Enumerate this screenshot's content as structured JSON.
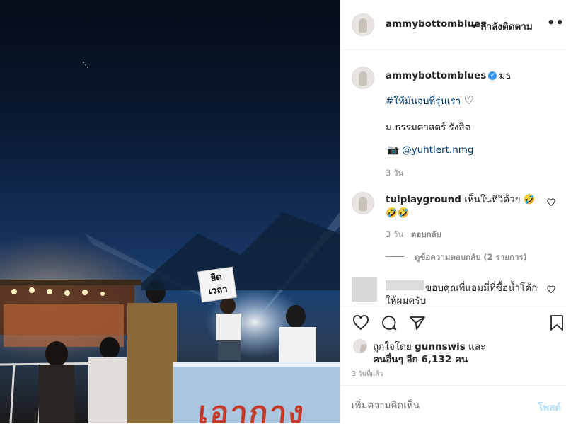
{
  "photo": {
    "sign_line1": "ยืด",
    "sign_line2": "เวลา",
    "banner_text": "เอากาง"
  },
  "header": {
    "username": "ammybottomblues",
    "follow_status": "• กำลังติดตาม"
  },
  "caption": {
    "username": "ammybottomblues",
    "location_tag": "มธ",
    "hashtag": "#ให้มันจบที่รุ่นเรา",
    "heart": "♡",
    "text": "ม.ธรรมศาสตร์ รังสิต",
    "camera_icon": "📷",
    "credit": "@yuhtlert.nmg",
    "time": "3 วัน"
  },
  "comments": [
    {
      "username": "tuiplayground",
      "text_line1": "เห็นในทีวีด้วย 🤣",
      "text_line2": "🤣🤣",
      "time": "3 วัน",
      "reply_label": "ตอบกลับ",
      "view_replies": "ดูข้อความตอบกลับ (2 รายการ)"
    },
    {
      "text_line1": "ขอบคุณพี่แอมมี่ที่ซื้อน้ำโค้ก",
      "text_line2": "ให้ผมครับ"
    }
  ],
  "likes": {
    "prefix": "ถูกใจโดย",
    "user": "gunnswis",
    "connector": "และ",
    "others": "คนอื่นๆ อีก 6,132 คน"
  },
  "post_time": "3 วันที่แล้ว",
  "add_comment": {
    "placeholder": "เพิ่มความคิดเห็น",
    "post_label": "โพสต์"
  },
  "colors": {
    "accent": "#3897f0",
    "muted": "#8e8e8e"
  }
}
